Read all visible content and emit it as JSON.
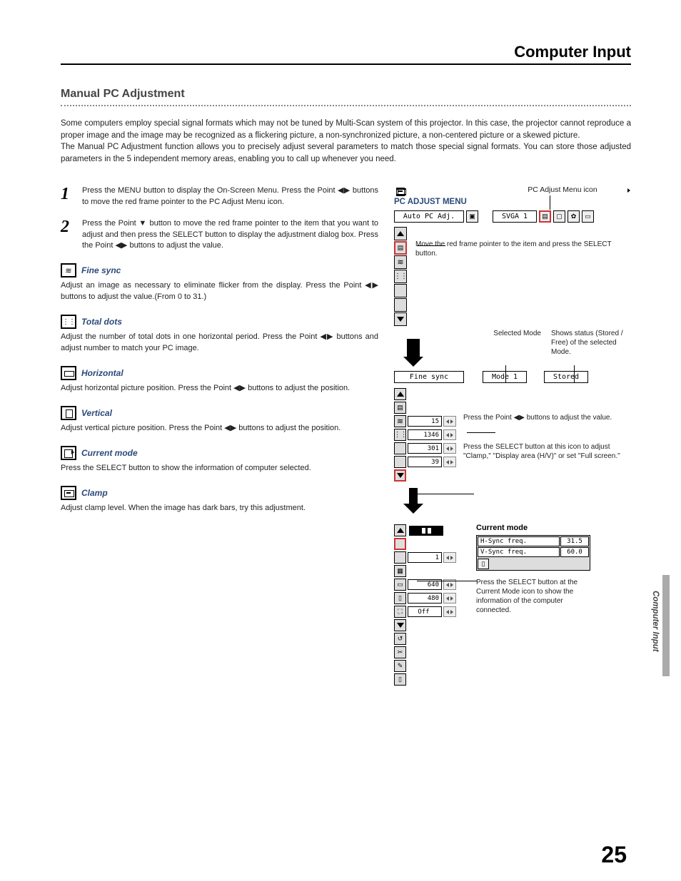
{
  "header": {
    "chapter": "Computer Input"
  },
  "section_title": "Manual PC Adjustment",
  "intro": {
    "p1": "Some computers employ special signal formats which may not be tuned by Multi-Scan system of this projector.  In this case, the projector cannot reproduce a proper image and the image may be recognized as a flickering picture, a non-synchronized picture, a non-centered picture or a skewed picture.",
    "p2": "The Manual PC Adjustment function allows you to precisely adjust several parameters to match those special signal formats. You can store those adjusted parameters in the 5 independent memory areas, enabling you to call up whenever you need."
  },
  "steps": [
    {
      "num": "1",
      "text": "Press the MENU button to display the On-Screen Menu. Press the Point ◀▶ buttons to move the red frame pointer to the PC Adjust Menu icon."
    },
    {
      "num": "2",
      "text": "Press the Point ▼ button to move the red frame pointer to the item that you want to adjust and then press the SELECT button to display the adjustment dialog box.  Press the Point ◀▶ buttons to adjust the value."
    }
  ],
  "items": [
    {
      "icon": "ic-finesync",
      "title": "Fine sync",
      "desc": "Adjust an image as necessary to eliminate flicker from the display. Press the Point ◀▶ buttons to adjust the value.(From 0 to 31.)"
    },
    {
      "icon": "ic-totaldots",
      "title": "Total dots",
      "desc": "Adjust the number of total dots in one horizontal period.  Press the Point ◀▶ buttons and adjust number to match your PC image."
    },
    {
      "icon": "ic-horiz",
      "title": "Horizontal",
      "desc": "Adjust horizontal picture position.  Press the Point ◀▶ buttons to adjust the position."
    },
    {
      "icon": "ic-vert",
      "title": "Vertical",
      "desc": "Adjust vertical picture position.  Press the Point ◀▶ buttons to adjust the position."
    },
    {
      "icon": "ic-current",
      "title": "Current mode",
      "desc": "Press the SELECT button to show the information of computer selected."
    },
    {
      "icon": "ic-clamp",
      "title": "Clamp",
      "desc": "Adjust clamp level.  When the image has dark bars, try this adjustment."
    }
  ],
  "diagram": {
    "icon_label": "PC Adjust Menu icon",
    "menu_title": "PC ADJUST MENU",
    "topbar_left": "Auto PC Adj.",
    "topbar_mode": "SVGA 1",
    "annot1": "Move the red frame pointer to the item and press the SELECT button.",
    "selected_mode_label": "Selected Mode",
    "status_label": "Shows status (Stored / Free) of the selected Mode.",
    "row2_left": "Fine sync",
    "row2_mode": "Mode 1",
    "row2_status": "Stored",
    "vals": {
      "fine": "15",
      "total": "1346",
      "horiz": "301",
      "vert": "39"
    },
    "annot2": "Press the Point ◀▶ buttons to adjust the value.",
    "annot3": "Press the SELECT button at this icon to adjust \"Clamp,\" \"Display area (H/V)\" or set \"Full screen.\"",
    "current_title": "Current mode",
    "hsync_label": "H-Sync freq.",
    "hsync_val": "31.5",
    "vsync_label": "V-Sync freq.",
    "vsync_val": "60.0",
    "annot4": "Press the SELECT button at the Current Mode icon to show the information of the computer connected.",
    "vals2": {
      "clamp": "1",
      "w": "640",
      "h": "480",
      "full": "Off"
    }
  },
  "page_number": "25",
  "side_tab": "Computer Input"
}
